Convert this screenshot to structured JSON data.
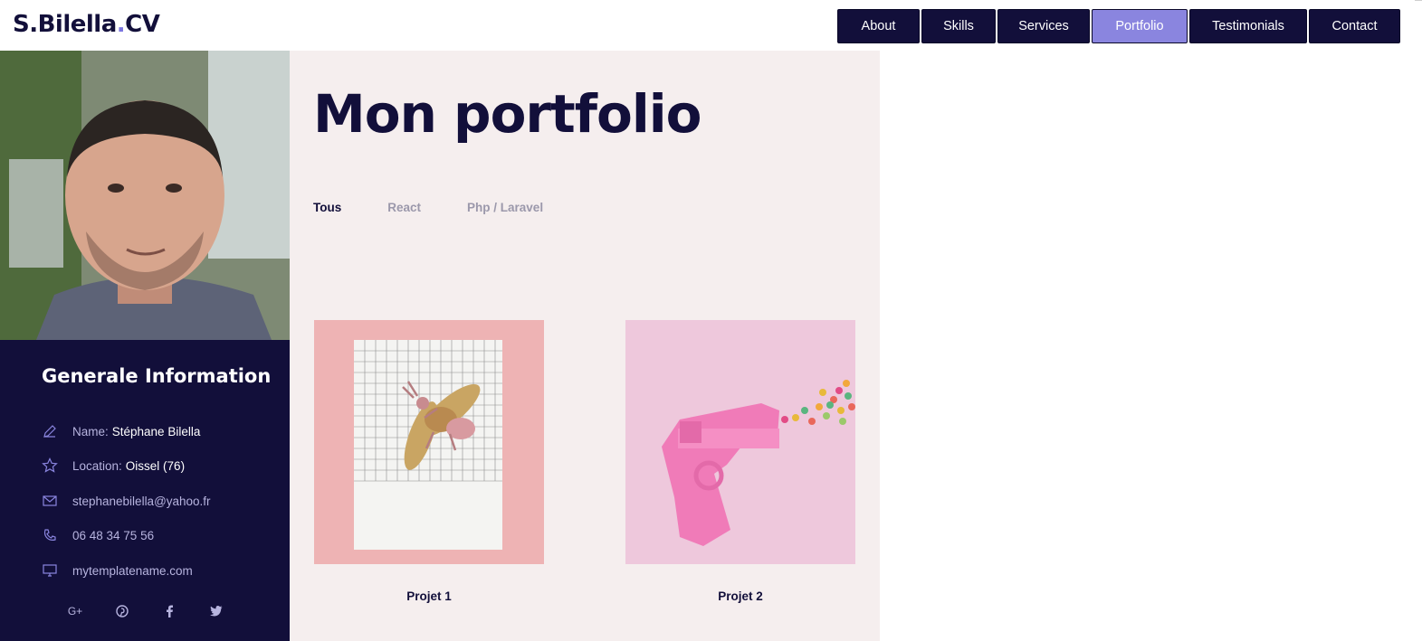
{
  "header": {
    "logo_main": "S.Bilella",
    "logo_dot": ".",
    "logo_suffix": "CV",
    "nav": [
      {
        "label": "About"
      },
      {
        "label": "Skills"
      },
      {
        "label": "Services"
      },
      {
        "label": "Portfolio",
        "active": true
      },
      {
        "label": "Testimonials"
      },
      {
        "label": "Contact"
      }
    ]
  },
  "sidebar": {
    "title": "Generale Information",
    "name_label": "Name:",
    "name_value": "Stéphane Bilella",
    "location_label": "Location:",
    "location_value": "Oissel (76)",
    "email": "stephanebilella@yahoo.fr",
    "phone": "06 48 34 75 56",
    "website": "mytemplatename.com",
    "socials": [
      "google-plus-icon",
      "pinterest-icon",
      "facebook-icon",
      "twitter-icon"
    ]
  },
  "main": {
    "title": "Mon portfolio",
    "filters": [
      {
        "label": "Tous",
        "active": true
      },
      {
        "label": "React"
      },
      {
        "label": "Php / Laravel"
      }
    ],
    "projects": [
      {
        "caption": "Projet 1"
      },
      {
        "caption": "Projet 2"
      }
    ]
  },
  "colors": {
    "navy": "#120f3a",
    "accent": "#8a85df",
    "main_bg": "#f5eeee"
  }
}
